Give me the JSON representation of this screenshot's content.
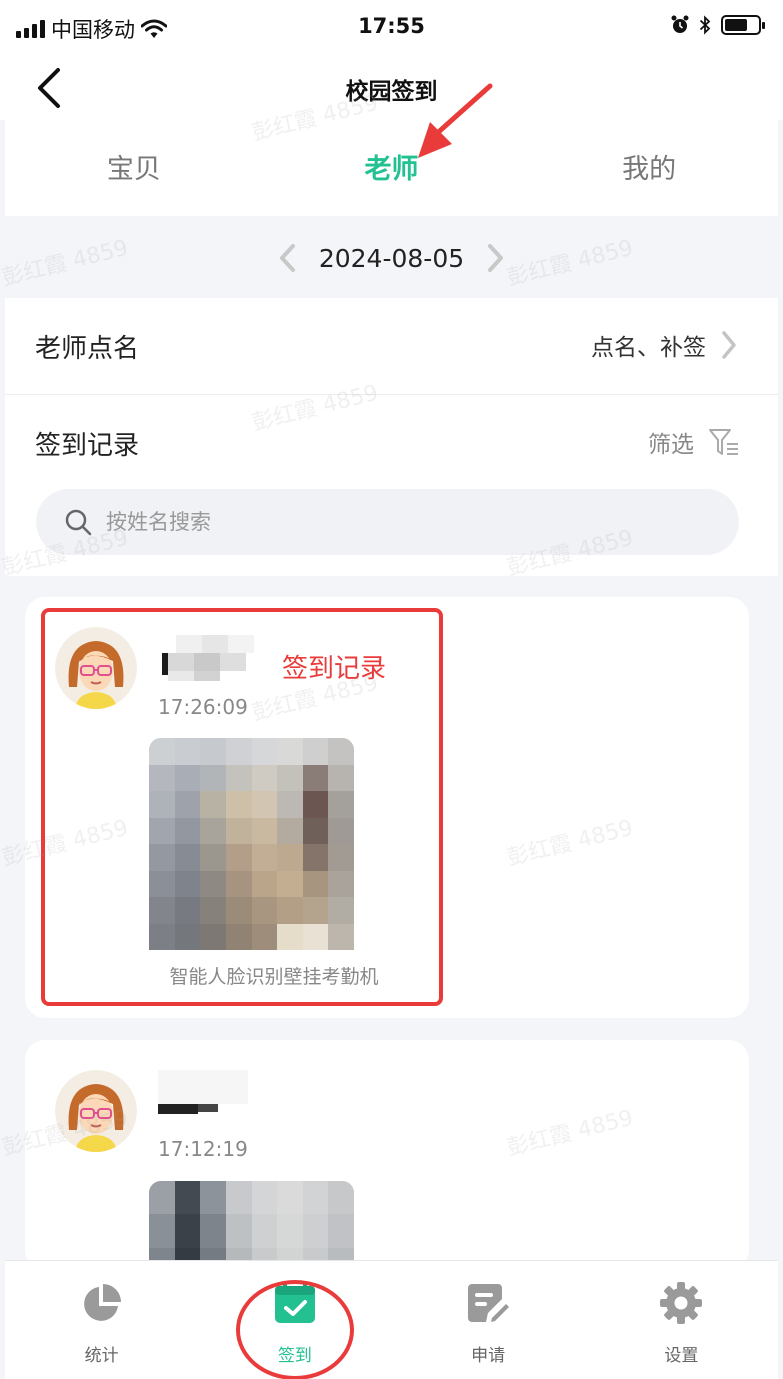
{
  "status_bar": {
    "carrier": "中国移动",
    "time": "17:55",
    "battery_level": 0.7
  },
  "nav": {
    "title": "校园签到",
    "back_icon": "chevron-left-icon"
  },
  "tabs": [
    {
      "label": "宝贝",
      "active": false
    },
    {
      "label": "老师",
      "active": true
    },
    {
      "label": "我的",
      "active": false
    }
  ],
  "date_nav": {
    "date": "2024-08-05",
    "prev_icon": "chevron-left-icon",
    "next_icon": "chevron-right-icon"
  },
  "roll_call": {
    "label": "老师点名",
    "action": "点名、补签"
  },
  "records_header": {
    "label": "签到记录",
    "filter_label": "筛选",
    "filter_icon": "filter-icon"
  },
  "search": {
    "placeholder": "按姓名搜索",
    "icon": "search-icon"
  },
  "records": [
    {
      "time": "17:26:09",
      "device": "智能人脸识别壁挂考勤机"
    },
    {
      "time": "17:12:19"
    }
  ],
  "annotation": {
    "label": "签到记录"
  },
  "bottom_tabs": [
    {
      "label": "统计",
      "icon": "pie-chart-icon",
      "active": false
    },
    {
      "label": "签到",
      "icon": "calendar-check-icon",
      "active": true
    },
    {
      "label": "申请",
      "icon": "edit-document-icon",
      "active": false
    },
    {
      "label": "设置",
      "icon": "gear-icon",
      "active": false
    }
  ],
  "colors": {
    "accent": "#23c192",
    "annotation_red": "#ea3b3b",
    "background": "#f4f5f9"
  }
}
